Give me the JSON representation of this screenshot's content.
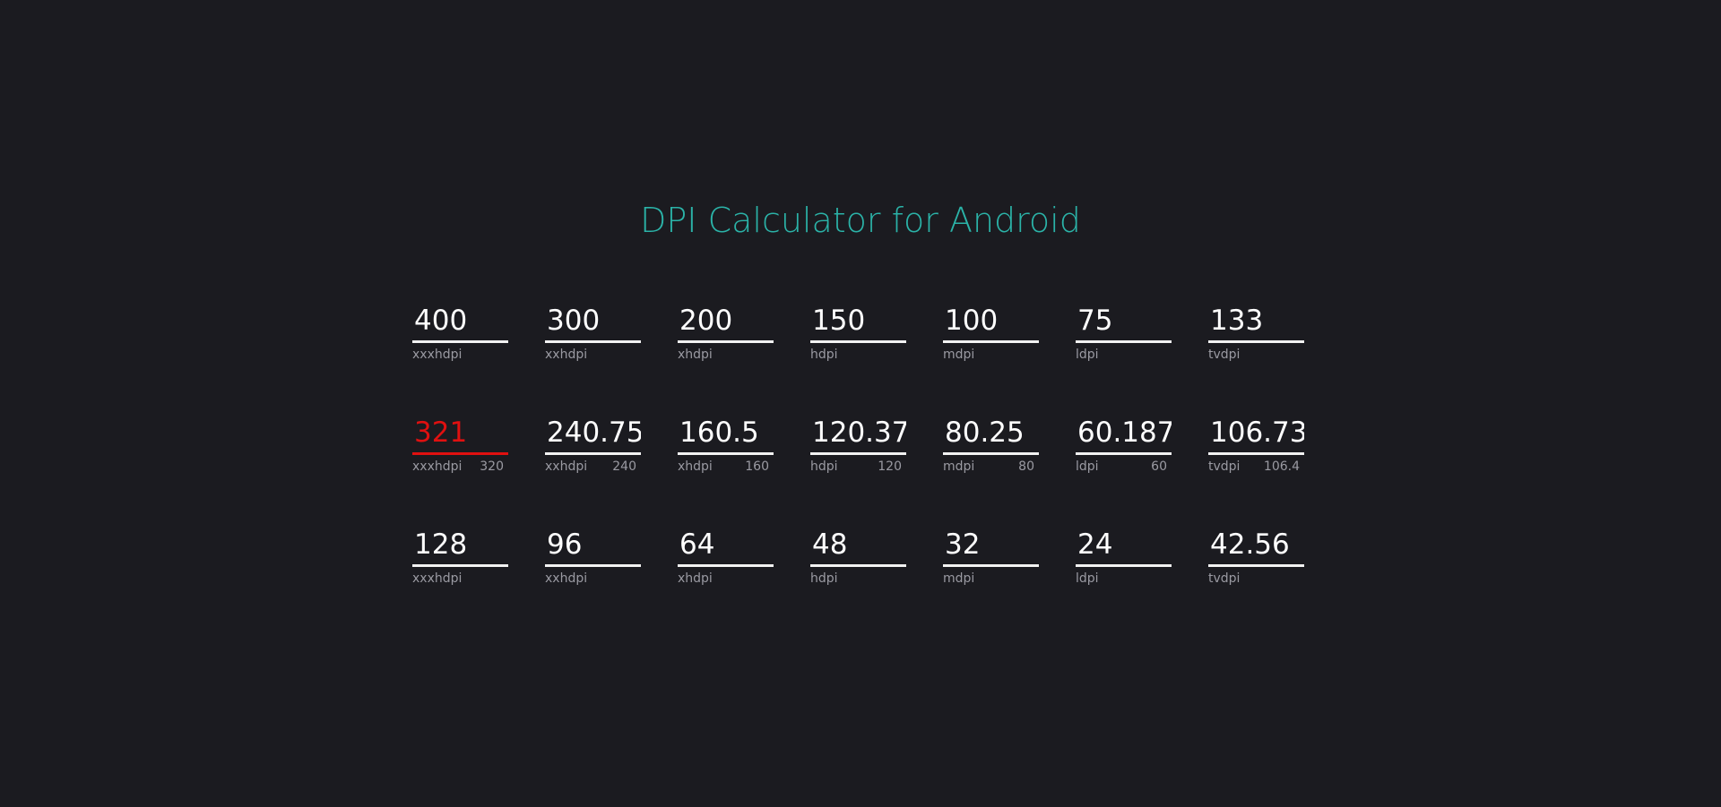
{
  "title": "DPI Calculator for Android",
  "colors": {
    "background": "#1b1b20",
    "title": "#2bb3a8",
    "text": "#ffffff",
    "label": "#9a9aa2",
    "error": "#e01010"
  },
  "rows": [
    {
      "fields": [
        {
          "value": "400",
          "label": "xxxhdpi",
          "hint": ""
        },
        {
          "value": "300",
          "label": "xxhdpi",
          "hint": ""
        },
        {
          "value": "200",
          "label": "xhdpi",
          "hint": ""
        },
        {
          "value": "150",
          "label": "hdpi",
          "hint": ""
        },
        {
          "value": "100",
          "label": "mdpi",
          "hint": ""
        },
        {
          "value": "75",
          "label": "ldpi",
          "hint": ""
        },
        {
          "value": "133",
          "label": "tvdpi",
          "hint": ""
        }
      ]
    },
    {
      "fields": [
        {
          "value": "321",
          "label": "xxxhdpi",
          "hint": "320",
          "error": true
        },
        {
          "value": "240.75",
          "label": "xxhdpi",
          "hint": "240"
        },
        {
          "value": "160.5",
          "label": "xhdpi",
          "hint": "160"
        },
        {
          "value": "120.37",
          "label": "hdpi",
          "hint": "120"
        },
        {
          "value": "80.25",
          "label": "mdpi",
          "hint": "80"
        },
        {
          "value": "60.187",
          "label": "ldpi",
          "hint": "60"
        },
        {
          "value": "106.73",
          "label": "tvdpi",
          "hint": "106.4"
        }
      ]
    },
    {
      "fields": [
        {
          "value": "128",
          "label": "xxxhdpi",
          "hint": ""
        },
        {
          "value": "96",
          "label": "xxhdpi",
          "hint": ""
        },
        {
          "value": "64",
          "label": "xhdpi",
          "hint": ""
        },
        {
          "value": "48",
          "label": "hdpi",
          "hint": ""
        },
        {
          "value": "32",
          "label": "mdpi",
          "hint": ""
        },
        {
          "value": "24",
          "label": "ldpi",
          "hint": ""
        },
        {
          "value": "42.56",
          "label": "tvdpi",
          "hint": ""
        }
      ]
    }
  ]
}
